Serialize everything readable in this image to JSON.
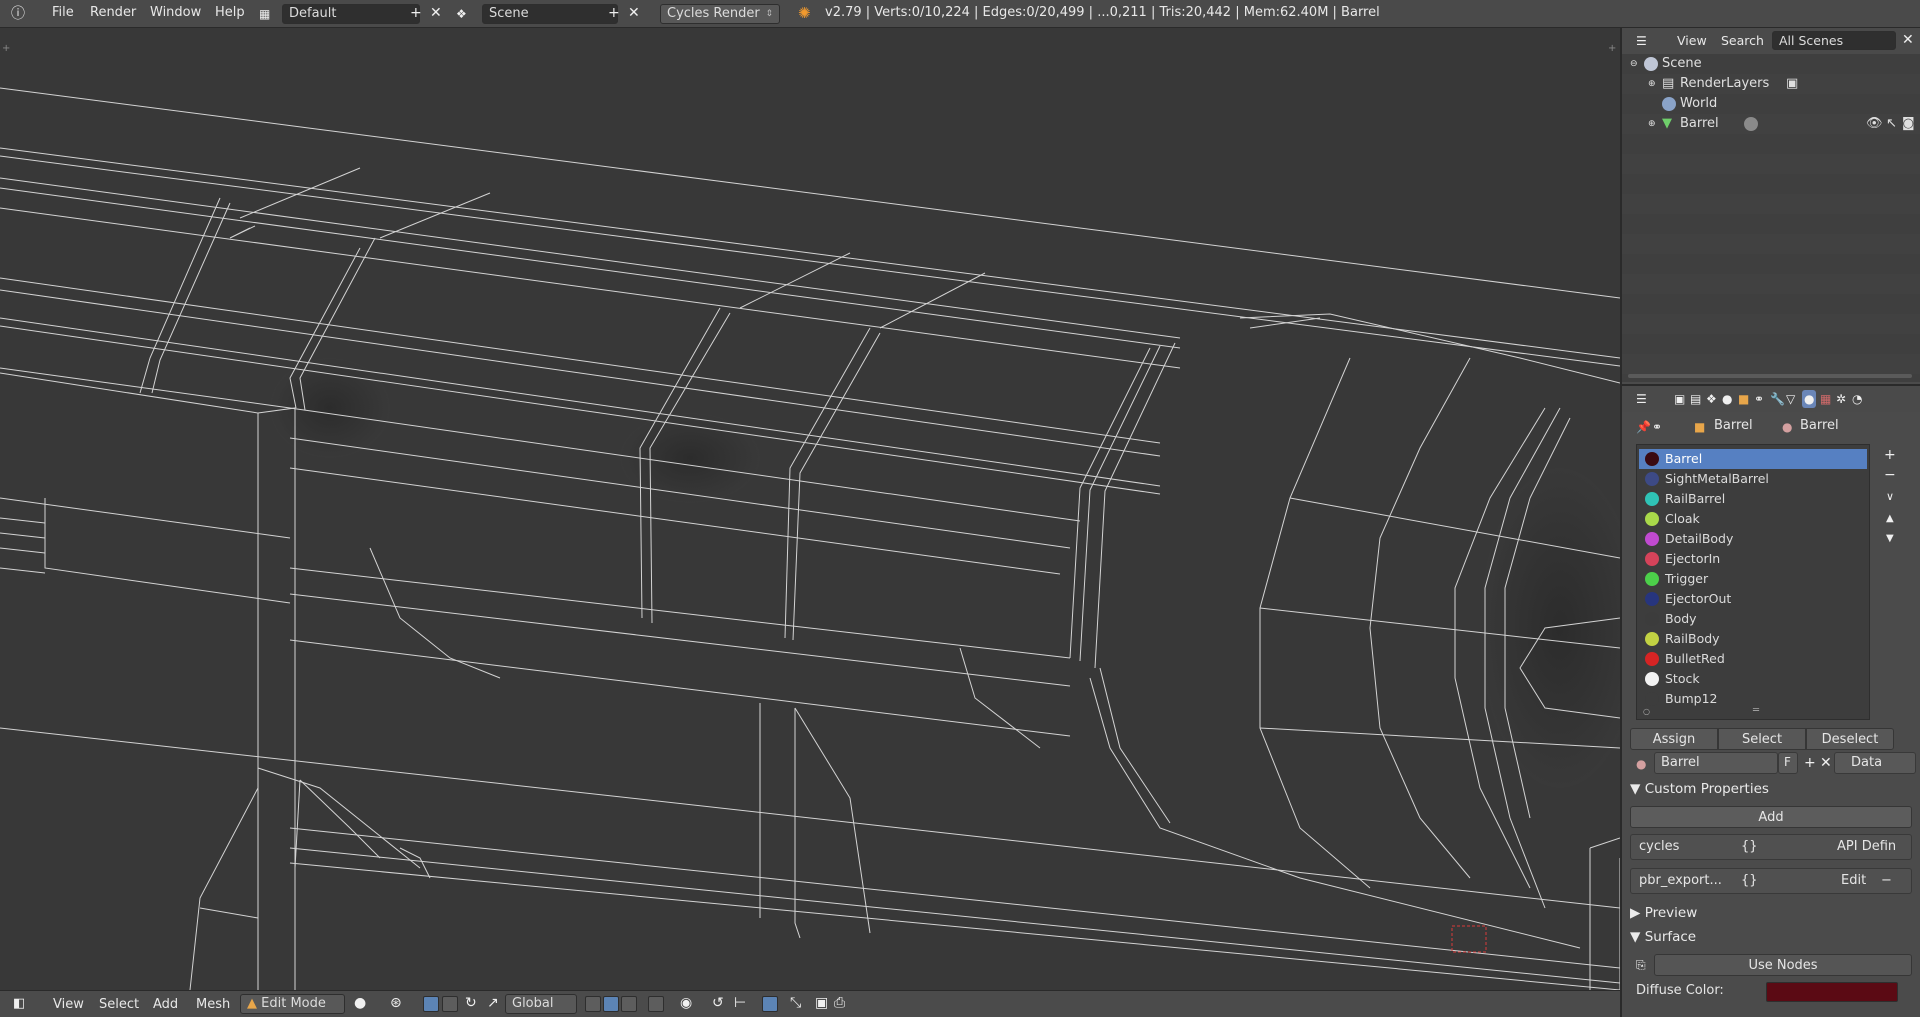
{
  "topbar": {
    "menus": [
      "File",
      "Render",
      "Window",
      "Help"
    ],
    "layout": "Default",
    "scene": "Scene",
    "engine": "Cycles Render",
    "stats": "v2.79 | Verts:0/10,224 | Edges:0/20,499 | ...0,211 | Tris:20,442 | Mem:62.40M | Barrel"
  },
  "outliner": {
    "header": {
      "view": "View",
      "search": "Search",
      "filter": "All Scenes"
    },
    "items": [
      {
        "label": "Scene"
      },
      {
        "label": "RenderLayers"
      },
      {
        "label": "World"
      },
      {
        "label": "Barrel"
      }
    ]
  },
  "properties": {
    "breadcrumb": [
      "Barrel",
      "Barrel"
    ],
    "materials": [
      {
        "name": "Barrel",
        "color": "#3a0a12",
        "selected": true
      },
      {
        "name": "SightMetalBarrel",
        "color": "#3d4a86"
      },
      {
        "name": "RailBarrel",
        "color": "#2fc3b6"
      },
      {
        "name": "Cloak",
        "color": "#a9d94a"
      },
      {
        "name": "DetailBody",
        "color": "#c04ad0"
      },
      {
        "name": "EjectorIn",
        "color": "#d5435a"
      },
      {
        "name": "Trigger",
        "color": "#4ccf4a"
      },
      {
        "name": "EjectorOut",
        "color": "#27357e"
      },
      {
        "name": "Body",
        "color": "#3c3c3c"
      },
      {
        "name": "RailBody",
        "color": "#c2d243"
      },
      {
        "name": "BulletRed",
        "color": "#d62424"
      },
      {
        "name": "Stock",
        "color": "#f2f2f2"
      },
      {
        "name": "Bump12",
        "color": "#3d3d3d"
      }
    ],
    "actions": {
      "assign": "Assign",
      "select": "Select",
      "deselect": "Deselect"
    },
    "datablock": {
      "name": "Barrel",
      "fake": "F",
      "link": "Data"
    },
    "custom_properties": {
      "title": "Custom Properties",
      "add": "Add",
      "rows": [
        {
          "key": "cycles",
          "value": "{}",
          "action": "API Defin"
        },
        {
          "key": "pbr_export...",
          "value": "{}",
          "action": "Edit"
        }
      ]
    },
    "preview": "Preview",
    "surface": "Surface",
    "use_nodes": "Use Nodes",
    "diffuse_label": "Diffuse Color:",
    "diffuse_color": "#5b0a14"
  },
  "bottombar": {
    "view": "View",
    "select": "Select",
    "add": "Add",
    "mesh": "Mesh",
    "mode": "Edit Mode",
    "orientation": "Global"
  }
}
